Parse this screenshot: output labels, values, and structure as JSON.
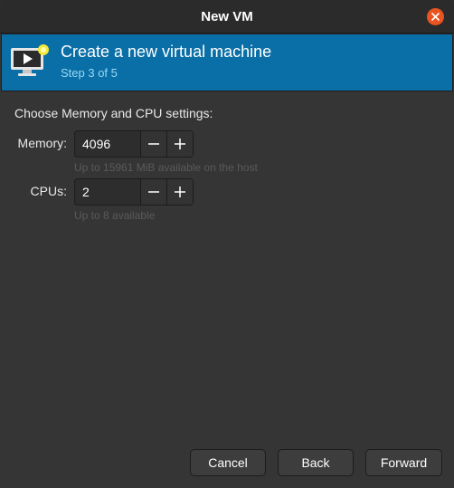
{
  "window": {
    "title": "New VM"
  },
  "banner": {
    "title": "Create a new virtual machine",
    "step": "Step 3 of 5",
    "icon": "new-vm-monitor-icon"
  },
  "settings": {
    "heading": "Choose Memory and CPU settings:",
    "memory": {
      "label": "Memory:",
      "value": "4096",
      "hint": "Up to 15961 MiB available on the host"
    },
    "cpus": {
      "label": "CPUs:",
      "value": "2",
      "hint": "Up to 8 available"
    }
  },
  "buttons": {
    "cancel": "Cancel",
    "back": "Back",
    "forward": "Forward"
  },
  "colors": {
    "banner": "#0a6fa6",
    "close": "#e95420"
  }
}
